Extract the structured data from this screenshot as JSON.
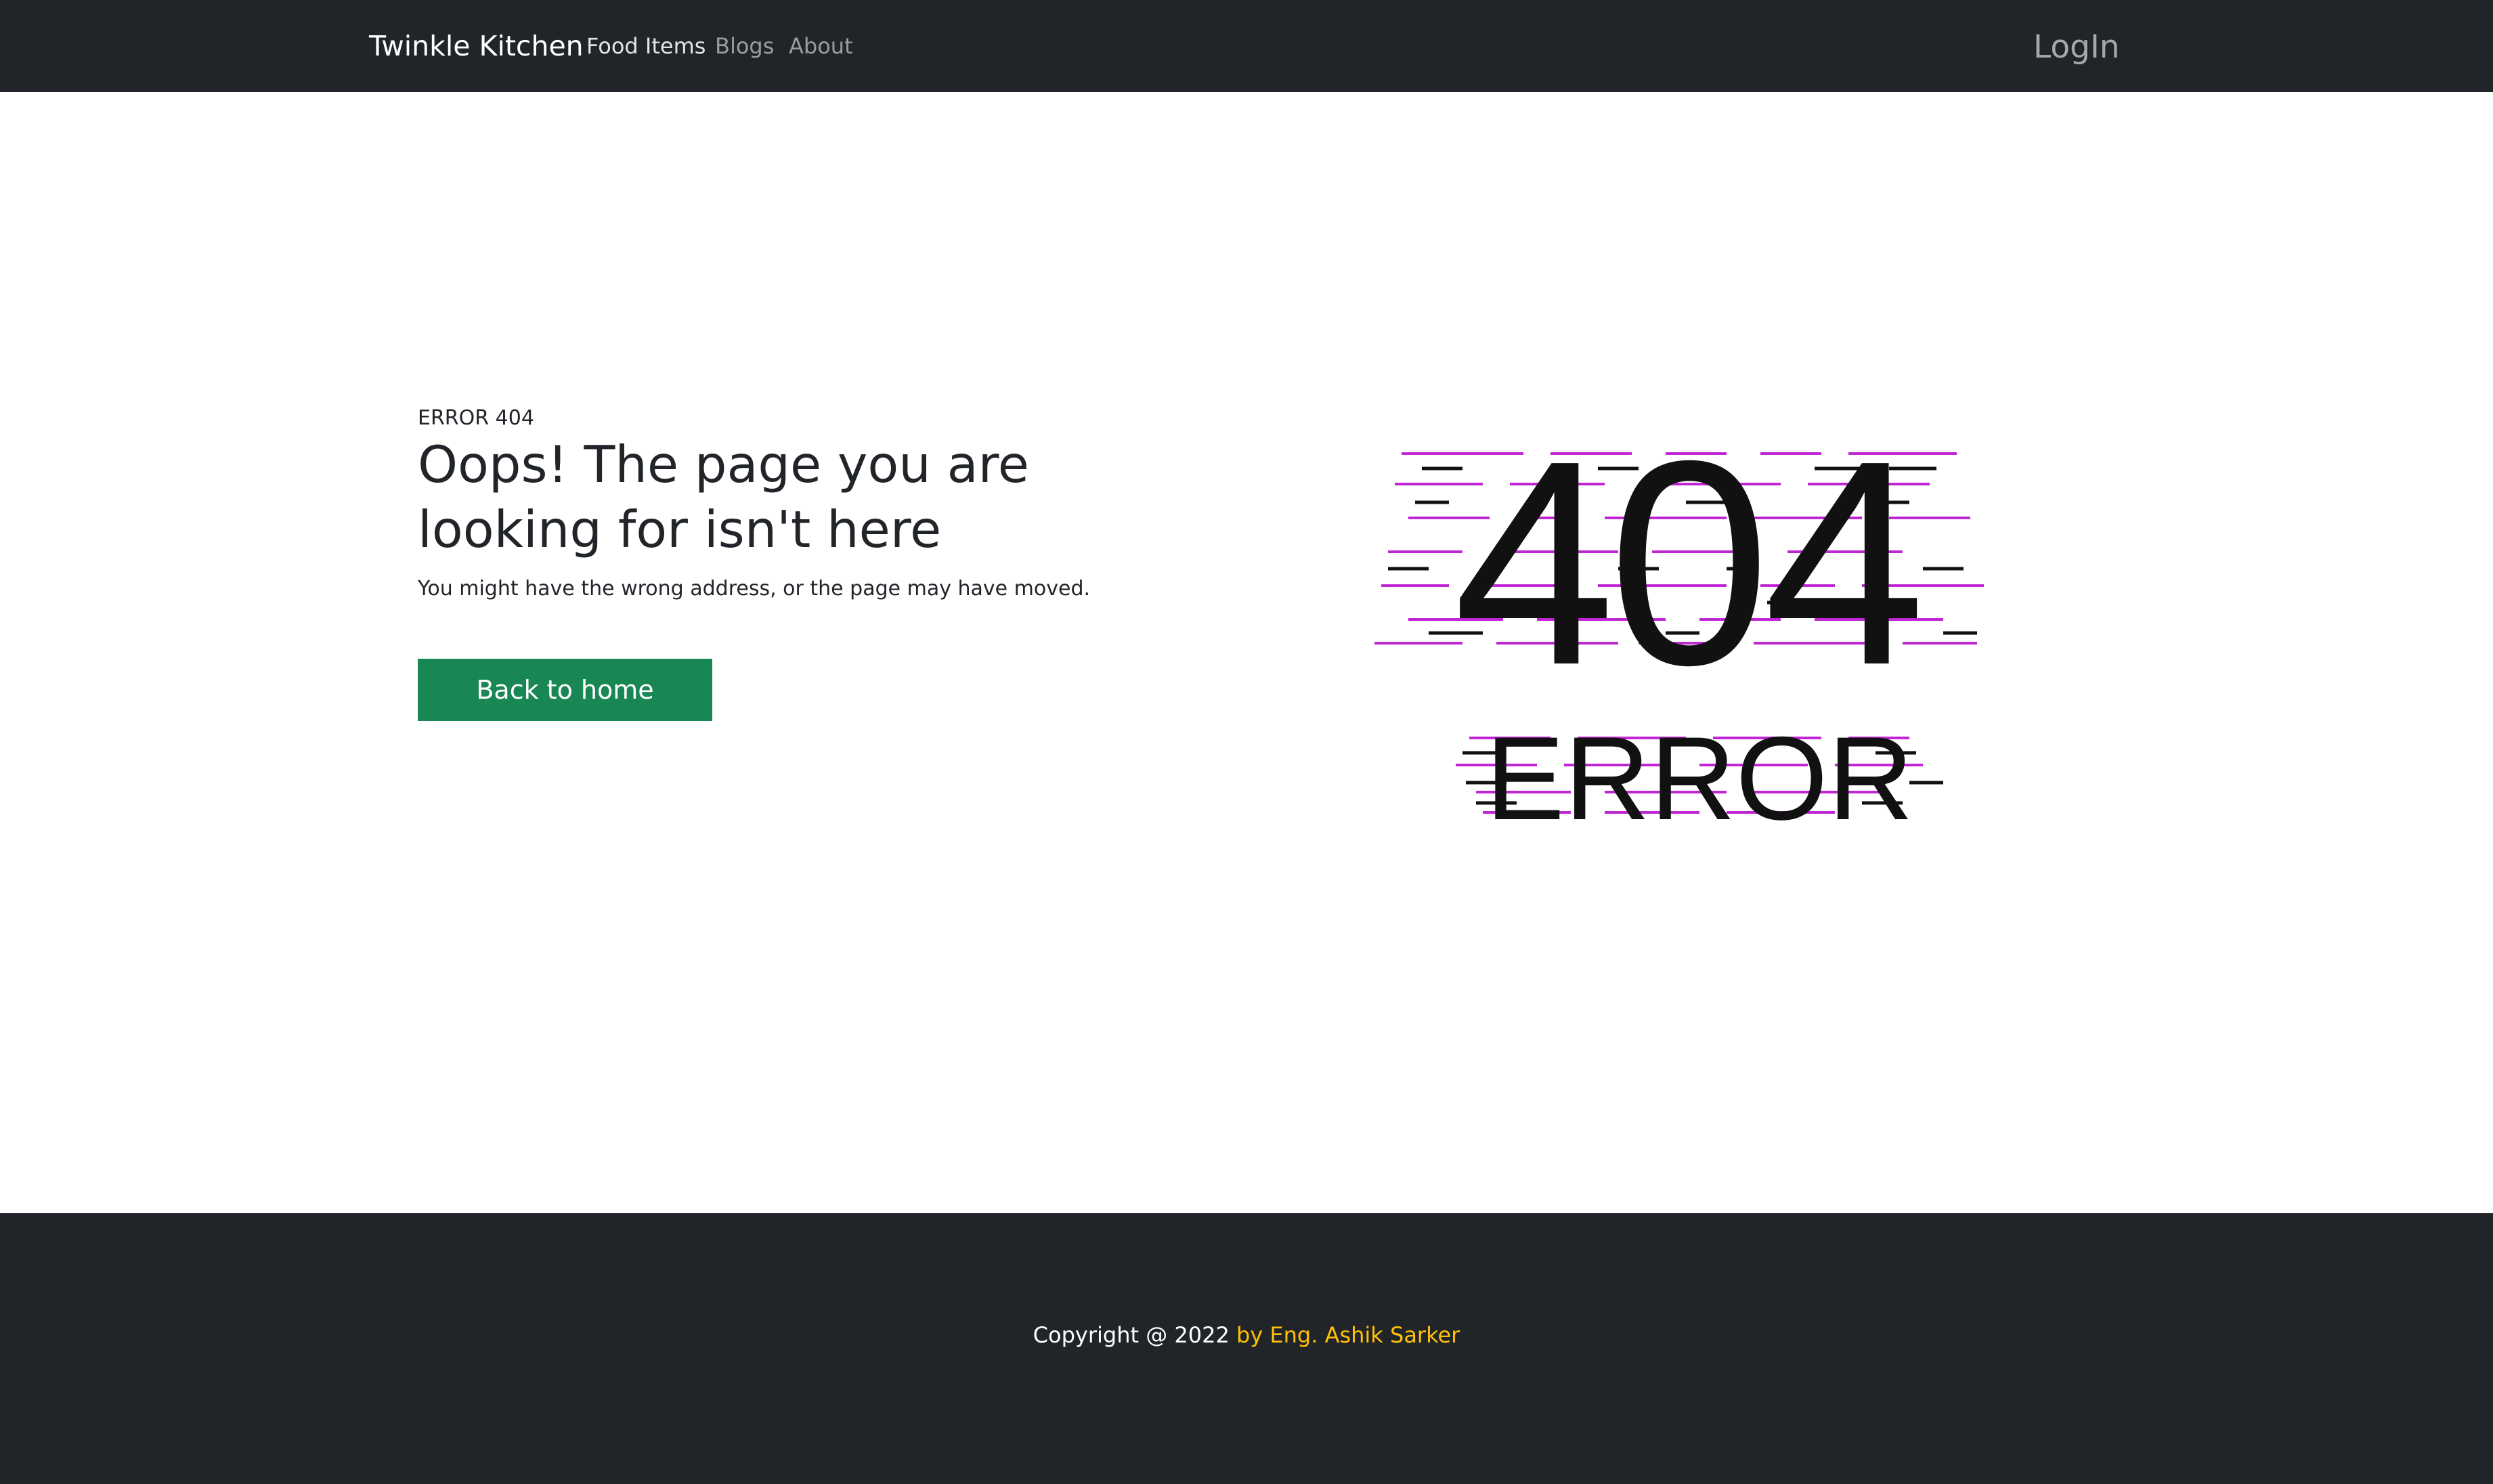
{
  "navbar": {
    "brand": "Twinkle Kitchen",
    "links": [
      {
        "label": "Food Items",
        "active": true
      },
      {
        "label": "Blogs",
        "active": false
      },
      {
        "label": "About",
        "active": false
      }
    ],
    "login_label": "LogIn"
  },
  "main": {
    "error_label": "ERROR 404",
    "headline": "Oops! The page you are looking for isn't here",
    "subtext": "You might have the wrong address, or the page may have moved.",
    "back_button_label": "Back to home",
    "illustration": {
      "code_text": "404",
      "error_text": "ERROR",
      "glitch_color": "#c026d3"
    }
  },
  "footer": {
    "copyright_prefix": "Copyright @ 2022 ",
    "author": "by Eng. Ashik Sarker",
    "author_color": "#ffc107"
  },
  "colors": {
    "navbar_bg": "#212529",
    "button_bg": "#198754"
  }
}
